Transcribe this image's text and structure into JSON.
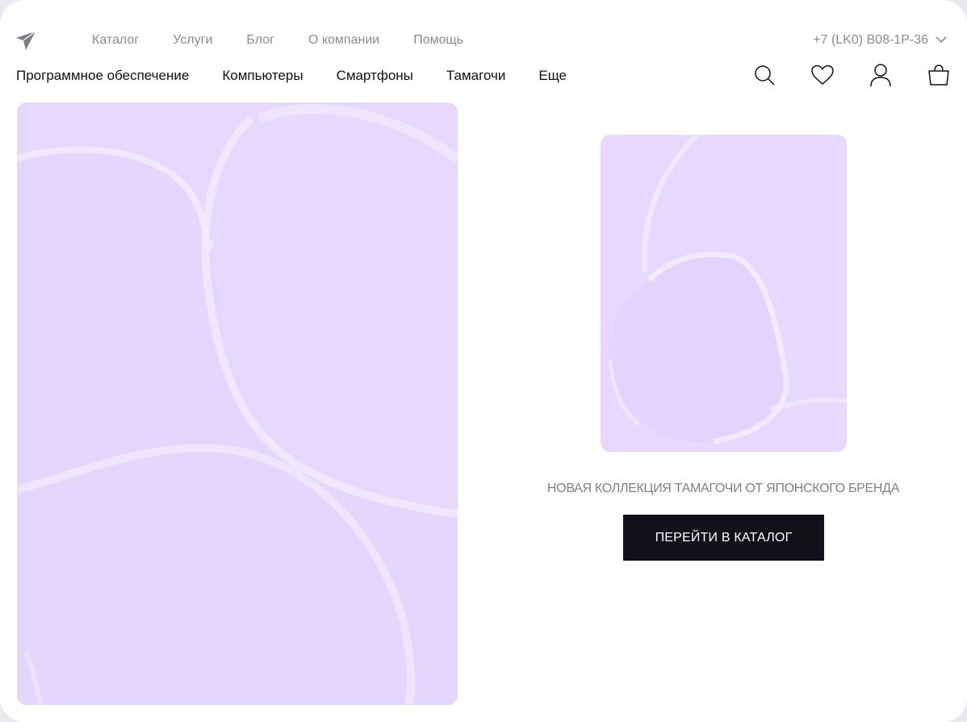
{
  "top_nav": {
    "items": [
      {
        "label": "Каталог"
      },
      {
        "label": "Услуги"
      },
      {
        "label": "Блог"
      },
      {
        "label": "О компании"
      },
      {
        "label": "Помощь"
      }
    ]
  },
  "phone": {
    "label": "+7 (LK0) B08-1P-36"
  },
  "main_nav": {
    "items": [
      {
        "label": "Программное обеспечение"
      },
      {
        "label": "Компьютеры"
      },
      {
        "label": "Смартфоны"
      },
      {
        "label": "Тамагочи"
      },
      {
        "label": "Еще"
      }
    ]
  },
  "header_icons": [
    "search-icon",
    "heart-icon",
    "user-icon",
    "bag-icon"
  ],
  "promo": {
    "text": "НОВАЯ КОЛЛЕКЦИЯ ТАМАГОЧИ ОТ ЯПОНСКОГО БРЕНДА",
    "button_label": "ПЕРЕЙТИ В КАТАЛОГ"
  },
  "colors": {
    "accent_bg": "#e6d9fd",
    "button_bg": "#12111a",
    "muted_text": "#8b8b93"
  }
}
